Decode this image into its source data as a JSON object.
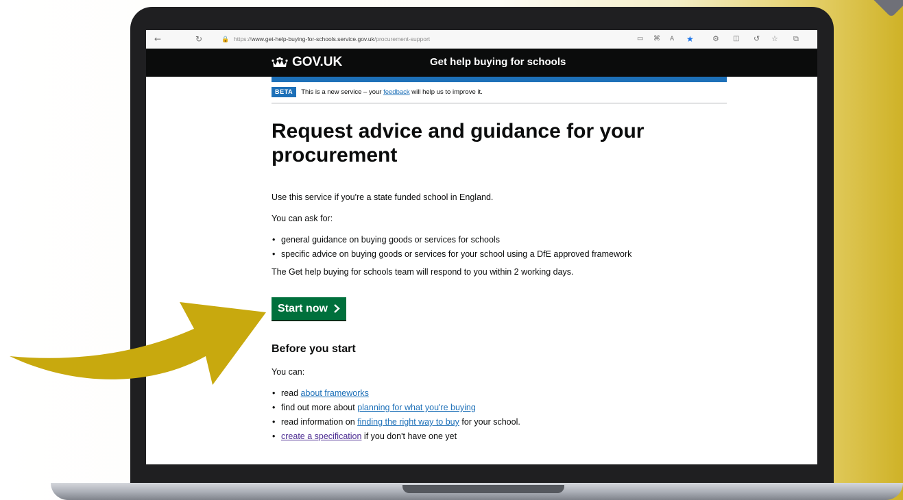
{
  "browser": {
    "url_prefix": "https://",
    "url_host": "www.get-help-buying-for-schools.service.gov.uk",
    "url_path": "/procurement-support",
    "icons": [
      "back-icon",
      "refresh-icon",
      "lock-icon",
      "reader-view-icon",
      "apps-icon",
      "read-aloud-icon",
      "favorite-star-icon",
      "extensions-icon",
      "screenshot-icon",
      "copilot-icon",
      "favorites-icon",
      "collections-icon"
    ]
  },
  "header": {
    "logo": "GOV.UK",
    "service_name": "Get help buying for schools"
  },
  "banner": {
    "tag": "BETA",
    "text_before": "This is a new service – your",
    "link": "feedback",
    "text_after": "will help us to improve it."
  },
  "main": {
    "title": "Request advice and guidance for your procurement",
    "intro": "Use this service if you're a state funded school in England.",
    "ask_for": "You can ask for:",
    "ask_items": [
      "general guidance on buying goods or services for schools",
      "specific advice on buying goods or services for your school using a DfE approved framework"
    ],
    "response": "The Get help buying for schools team will respond to you within 2 working days.",
    "start_button": "Start now"
  },
  "before": {
    "heading": "Before you start",
    "you_can": "You can:",
    "items": [
      {
        "before": "read",
        "link": "about frameworks",
        "after": ""
      },
      {
        "before": "find out more about",
        "link": "planning for what you're buying",
        "after": ""
      },
      {
        "before": "read information on",
        "link": "finding the right way to buy",
        "after": "for your school."
      },
      {
        "before": "",
        "link": "create a specification",
        "after": "if you don't have one yet"
      }
    ]
  },
  "colors": {
    "gov_black": "#0b0c0c",
    "gov_blue": "#1d70b8",
    "gov_green": "#00703c",
    "arrow_gold": "#c8a90e"
  }
}
